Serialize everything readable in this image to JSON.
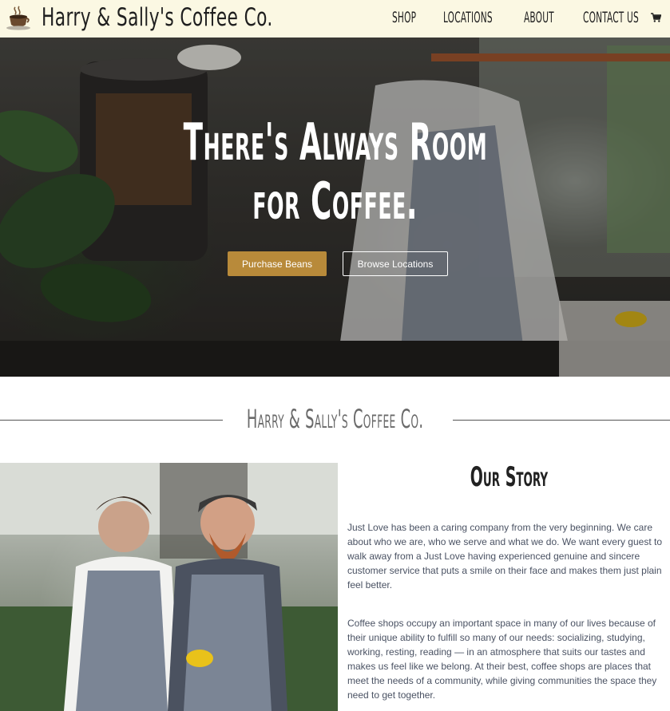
{
  "nav": {
    "brand": "Harry & Sally's Coffee Co.",
    "links": [
      "SHOP",
      "LOCATIONS",
      "ABOUT",
      "CONTACT US"
    ],
    "logo_icon": "coffee-cup-icon",
    "cart_icon": "shopping-cart-icon"
  },
  "hero": {
    "title_line1": "There's Always Room",
    "title_line2": "for Coffee.",
    "primary_button": "Purchase Beans",
    "secondary_button": "Browse Locations",
    "accent_color": "#b88a3a"
  },
  "divider": {
    "title": "Harry & Sally's Coffee Co."
  },
  "story": {
    "heading": "Our Story",
    "paragraph1": "Just Love has been a caring company from the very beginning. We care about who we are, who we serve and what we do. We want every guest to walk away from a Just Love having experienced genuine and sincere customer service that puts a smile on their face and makes them just plain feel better.",
    "paragraph2": "Coffee shops occupy an important space in many of our lives because of their unique ability to fulfill so many of our needs: socializing, studying, working, resting, reading — in an atmosphere that suits our tastes and makes us feel like we belong. At their best, coffee shops are places that meet the needs of a community, while giving communities the space they need to get together."
  }
}
